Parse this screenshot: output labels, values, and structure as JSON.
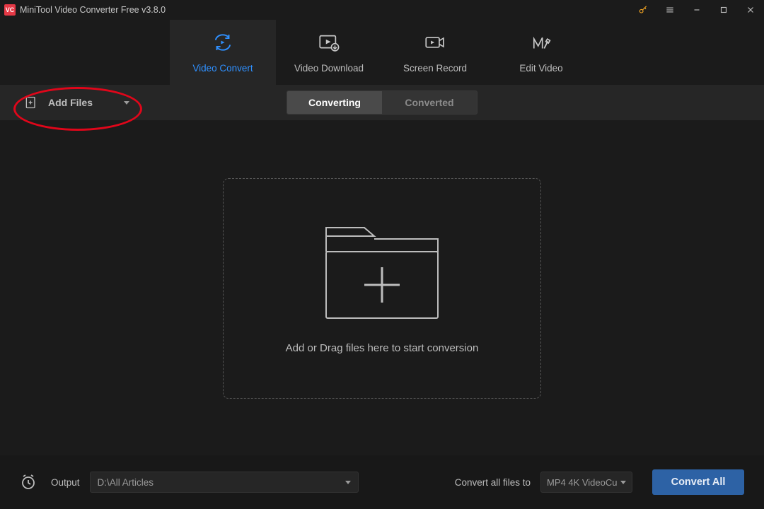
{
  "title": "MiniTool Video Converter Free v3.8.0",
  "nav": {
    "convert": "Video Convert",
    "download": "Video Download",
    "record": "Screen Record",
    "edit": "Edit Video"
  },
  "toolbar": {
    "add_files": "Add Files",
    "converting": "Converting",
    "converted": "Converted"
  },
  "dropzone": {
    "text": "Add or Drag files here to start conversion"
  },
  "bottom": {
    "output_label": "Output",
    "output_path": "D:\\All Articles",
    "convert_all_label": "Convert all files to",
    "format": "MP4 4K VideoCu",
    "convert_all_btn": "Convert All"
  }
}
